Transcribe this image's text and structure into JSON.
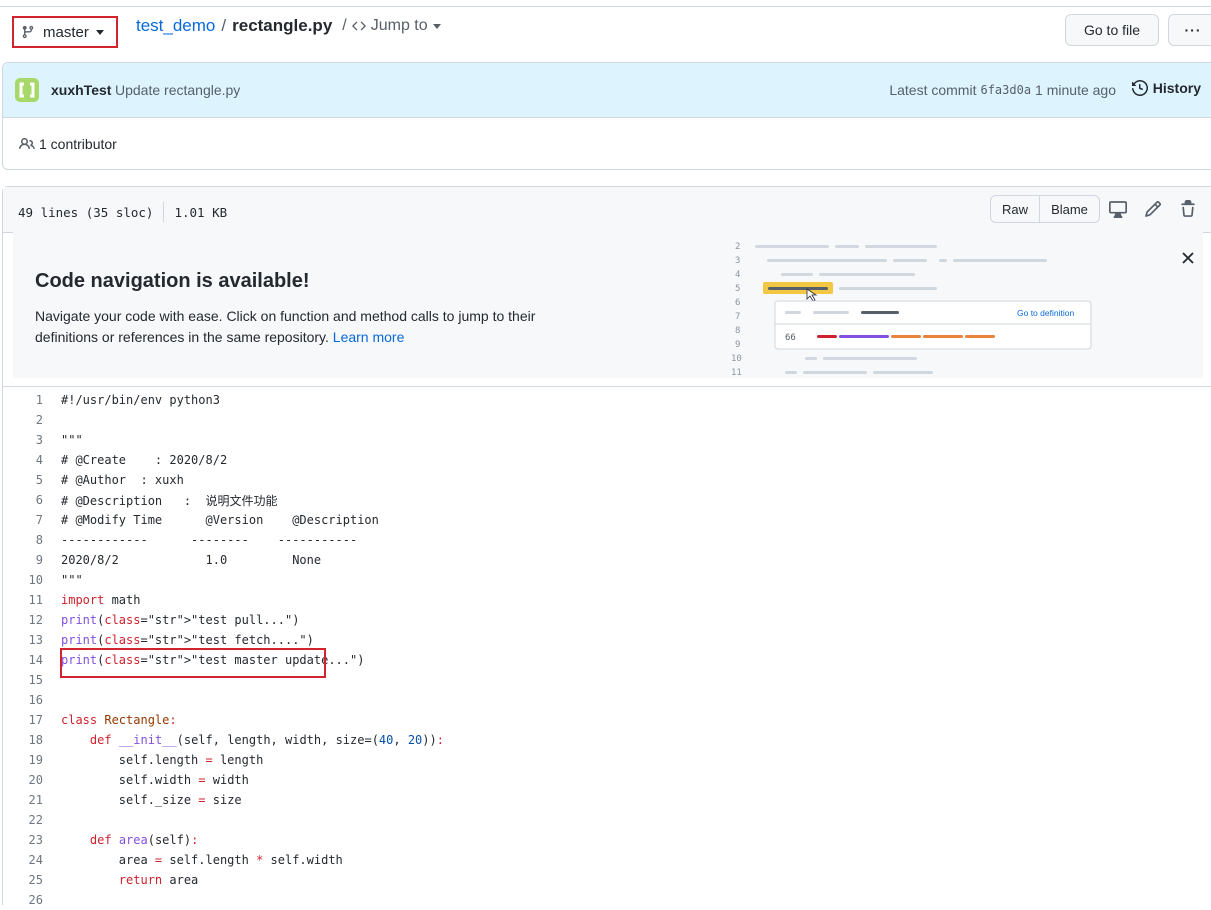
{
  "header": {
    "branch": "master",
    "repo": "test_demo",
    "separator": "/",
    "file": "rectangle.py",
    "jump_sep": "/",
    "jump_label": "Jump to",
    "go_to_file": "Go to file",
    "more": "···"
  },
  "commit": {
    "author": "xuxhTest",
    "message": "Update rectangle.py",
    "latest_label": "Latest commit",
    "sha": "6fa3d0a",
    "time": "1 minute ago",
    "history_label": "History",
    "contributors": "1 contributor"
  },
  "file": {
    "lines_info": "49 lines (35 sloc)",
    "size": "1.01 KB",
    "raw_label": "Raw",
    "blame_label": "Blame"
  },
  "promo": {
    "title": "Code navigation is available!",
    "text": "Navigate your code with ease. Click on function and method calls to jump to their definitions or references in the same repository.",
    "link": "Learn more",
    "illustration": {
      "line_numbers": [
        "2",
        "3",
        "4",
        "5",
        "6",
        "7",
        "8",
        "9",
        "10",
        "11"
      ],
      "popup_number": "66",
      "popup_link": "Go to definition"
    }
  },
  "code": {
    "lines": [
      {
        "n": "1",
        "t": "#!/usr/bin/env python3"
      },
      {
        "n": "2",
        "t": ""
      },
      {
        "n": "3",
        "t": "\"\"\""
      },
      {
        "n": "4",
        "t": "# @Create    : 2020/8/2"
      },
      {
        "n": "5",
        "t": "# @Author  : xuxh"
      },
      {
        "n": "6",
        "t": "# @Description   :  说明文件功能"
      },
      {
        "n": "7",
        "t": "# @Modify Time      @Version    @Description"
      },
      {
        "n": "8",
        "t": "------------      --------    -----------"
      },
      {
        "n": "9",
        "t": "2020/8/2            1.0         None"
      },
      {
        "n": "10",
        "t": "\"\"\""
      },
      {
        "n": "11",
        "t": "import math"
      },
      {
        "n": "12",
        "t": "print(\"test pull...\")"
      },
      {
        "n": "13",
        "t": "print(\"test fetch....\")"
      },
      {
        "n": "14",
        "t": "print(\"test master update...\")"
      },
      {
        "n": "15",
        "t": ""
      },
      {
        "n": "16",
        "t": ""
      },
      {
        "n": "17",
        "t": "class Rectangle:"
      },
      {
        "n": "18",
        "t": "    def __init__(self, length, width, size=(40, 20)):"
      },
      {
        "n": "19",
        "t": "        self.length = length"
      },
      {
        "n": "20",
        "t": "        self.width = width"
      },
      {
        "n": "21",
        "t": "        self._size = size"
      },
      {
        "n": "22",
        "t": ""
      },
      {
        "n": "23",
        "t": "    def area(self):"
      },
      {
        "n": "24",
        "t": "        area = self.length * self.width"
      },
      {
        "n": "25",
        "t": "        return area"
      },
      {
        "n": "26",
        "t": ""
      }
    ]
  },
  "colors": {
    "link": "#0969da",
    "annotation_red": "#d1242f",
    "commit_bg": "#ddf4ff",
    "keyword": "#cf222e",
    "function": "#8250df"
  }
}
